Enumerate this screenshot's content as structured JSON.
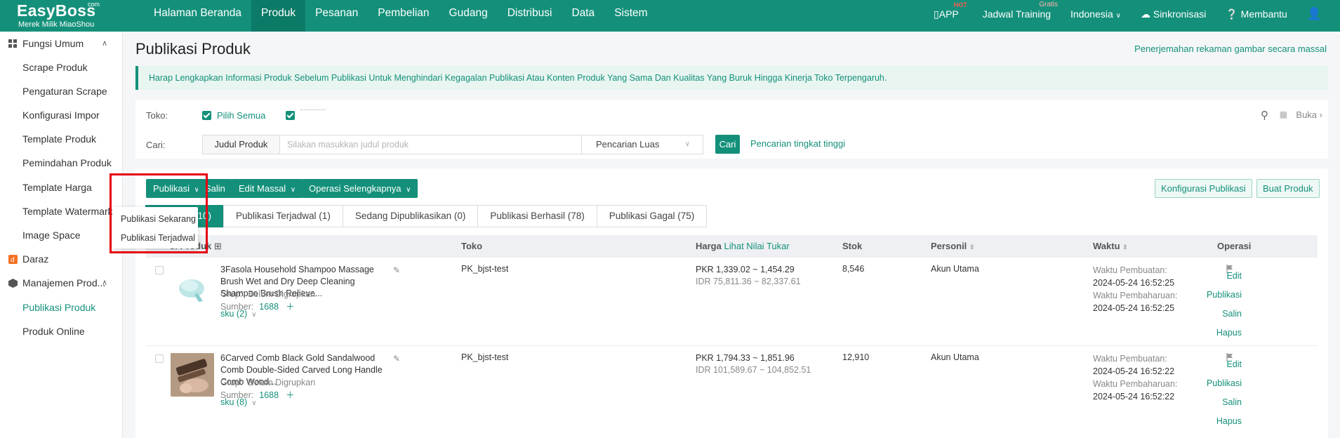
{
  "app": {
    "brand": "EasyBoss",
    "brand_suffix": "com",
    "tagline": "Merek Milik MiaoShou"
  },
  "nav": {
    "items": [
      "Halaman Beranda",
      "Produk",
      "Pesanan",
      "Pembelian",
      "Gudang",
      "Distribusi",
      "Data",
      "Sistem"
    ],
    "active": "Produk"
  },
  "topright": {
    "app": "APP",
    "app_badge": "HOT",
    "training": "Jadwal Training",
    "training_badge": "Gratis",
    "language": "Indonesia",
    "sync": "Sinkronisasi",
    "help": "Membantu"
  },
  "sidebar": {
    "group1": "Fungsi Umum",
    "group1_items": [
      "Scrape Produk",
      "Pengaturan Scrape",
      "Konfigurasi Impor",
      "Template Produk",
      "Pemindahan Produk",
      "Template Harga",
      "Template Watermark",
      "Image Space"
    ],
    "group2": "Daraz",
    "group3": "Manajemen Prod...",
    "group3_items": [
      "Publikasi Produk",
      "Produk Online"
    ],
    "active_item": "Publikasi Produk"
  },
  "page": {
    "title": "Publikasi Produk",
    "top_link": "Penerjemahan rekaman gambar secara massal",
    "notice": "Harap Lengkapkan Informasi Produk Sebelum Publikasi Untuk Menghindari Kegagalan Publikasi Atau Konten Produk Yang Sama Dan Kualitas Yang Buruk Hingga Kinerja Toko Terpengaruh."
  },
  "filter": {
    "toko_label": "Toko:",
    "select_all": "Pilih Semua",
    "cari_label": "Cari:",
    "search_field": "Judul Produk",
    "search_placeholder": "Silakan masukkan judul produk",
    "search_mode": "Pencarian Luas",
    "search_button": "Cari",
    "advanced": "Pencarian tingkat tinggi",
    "expand": "Buka"
  },
  "toolbar": {
    "publish": "Publikasi",
    "copy": "Salin",
    "bulk_edit": "Edit Massal",
    "more_ops": "Operasi Selengkapnya",
    "config_publish": "Konfigurasi Publikasi",
    "create_product": "Buat Produk"
  },
  "publish_menu": {
    "items": [
      "Publikasi Sekarang",
      "Publikasi Terjadwal"
    ]
  },
  "tabs": [
    {
      "label": "110)",
      "active": true
    },
    {
      "label": "Publikasi Terjadwal (1)"
    },
    {
      "label": "Sedang Dipublikasikan (0)"
    },
    {
      "label": "Publikasi Berhasil (78)"
    },
    {
      "label": "Publikasi Gagal (75)"
    }
  ],
  "table": {
    "headers": {
      "product": "si Produk",
      "store": "Toko",
      "price": "Harga",
      "price_link": "Lihat Nilai Tukar",
      "stock": "Stok",
      "personnel": "Personil",
      "time": "Waktu",
      "ops": "Operasi"
    },
    "rows": [
      {
        "title": "3Fasola Household Shampoo Massage Brush Wet and Dry Deep Cleaning Shampoo Brush Relieve...",
        "group_label": "Grup:",
        "group": "Belum Digrupkan",
        "source_label": "Sumber:",
        "source": "1688",
        "sku": "sku (2)",
        "store": "PK_bjst-test",
        "price_pkr": "PKR 1,339.02 ~ 1,454.29",
        "price_idr": "IDR 75,811.36 ~ 82,337.61",
        "stock": "8,546",
        "personnel": "Akun Utama",
        "created_label": "Waktu Pembuatan:",
        "created": "2024-05-24 16:52:25",
        "updated_label": "Waktu Pembaharuan:",
        "updated": "2024-05-24 16:52:25",
        "ops": [
          "Edit",
          "Publikasi",
          "Salin",
          "Hapus"
        ]
      },
      {
        "title": "6Carved Comb Black Gold Sandalwood Comb Double-Sided Carved Long Handle Comb Wood...",
        "group_label": "Grup:",
        "group": "Belum Digrupkan",
        "source_label": "Sumber:",
        "source": "1688",
        "sku": "sku (8)",
        "store": "PK_bjst-test",
        "price_pkr": "PKR 1,794.33 ~ 1,851.96",
        "price_idr": "IDR 101,589.67 ~ 104,852.51",
        "stock": "12,910",
        "personnel": "Akun Utama",
        "created_label": "Waktu Pembuatan:",
        "created": "2024-05-24 16:52:22",
        "updated_label": "Waktu Pembaharuan:",
        "updated": "2024-05-24 16:52:22",
        "ops": [
          "Edit",
          "Publikasi",
          "Salin",
          "Hapus"
        ]
      }
    ]
  },
  "colors": {
    "primary": "#14907a",
    "primary_dark": "#0b7a66",
    "highlight": "#e60012"
  }
}
